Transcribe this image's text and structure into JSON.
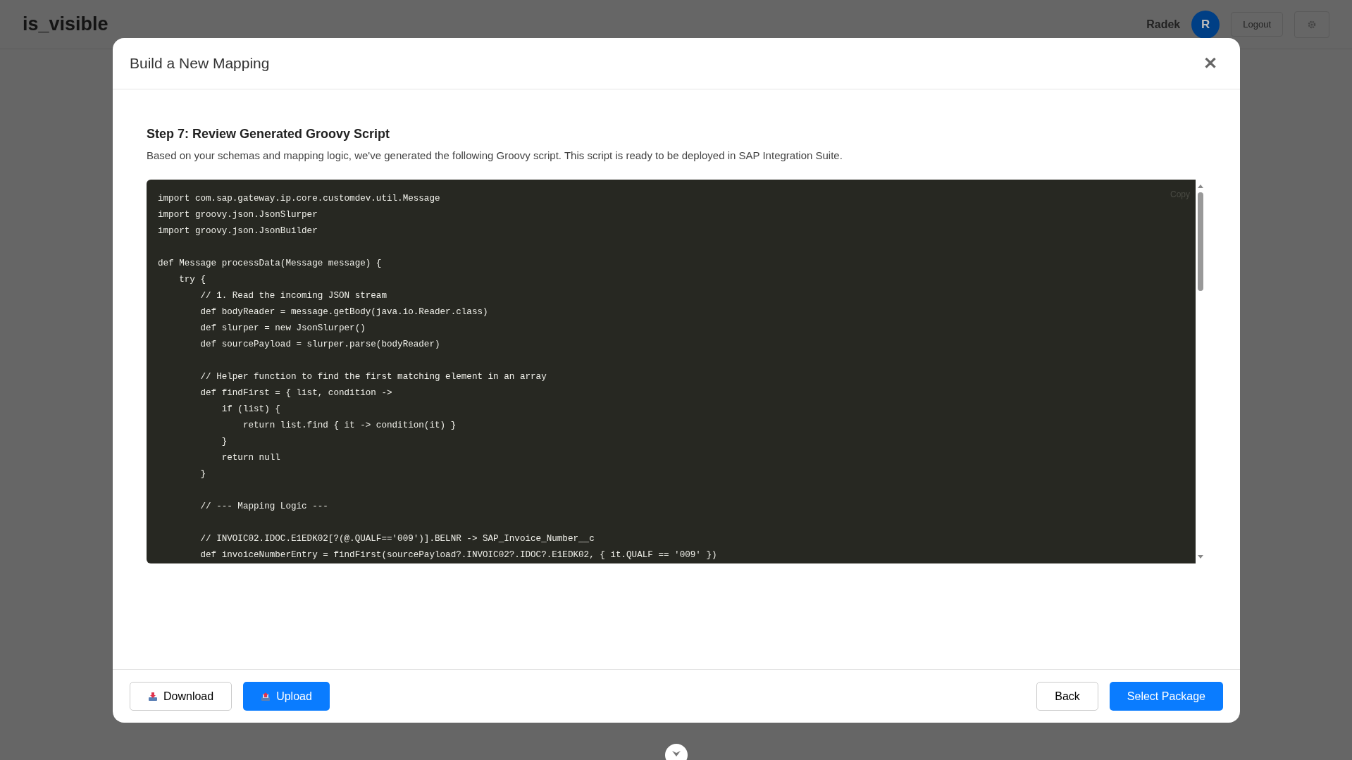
{
  "app_header": {
    "logo": "is_visible",
    "user_name": "Radek",
    "avatar_initial": "R",
    "logout": "Logout"
  },
  "dialog": {
    "title": "Build a New Mapping",
    "close": "✕",
    "step_title": "Step 7: Review Generated Groovy Script",
    "step_description": "Based on your schemas and mapping logic, we've generated the following Groovy script. This script is ready to be deployed in SAP Integration Suite.",
    "code": {
      "copy_label": "Copy",
      "text": "import com.sap.gateway.ip.core.customdev.util.Message\nimport groovy.json.JsonSlurper\nimport groovy.json.JsonBuilder\n\ndef Message processData(Message message) {\n    try {\n        // 1. Read the incoming JSON stream\n        def bodyReader = message.getBody(java.io.Reader.class)\n        def slurper = new JsonSlurper()\n        def sourcePayload = slurper.parse(bodyReader)\n\n        // Helper function to find the first matching element in an array\n        def findFirst = { list, condition ->\n            if (list) {\n                return list.find { it -> condition(it) }\n            }\n            return null\n        }\n\n        // --- Mapping Logic ---\n\n        // INVOIC02.IDOC.E1EDK02[?(@.QUALF=='009')].BELNR -> SAP_Invoice_Number__c\n        def invoiceNumberEntry = findFirst(sourcePayload?.INVOIC02?.IDOC?.E1EDK02, { it.QUALF == '009' })"
    },
    "footer_left": [
      {
        "label": "Download",
        "kind": "outline"
      },
      {
        "label": "Upload",
        "kind": "primary"
      }
    ],
    "footer_right": [
      {
        "label": "Back",
        "kind": "outline"
      },
      {
        "label": "Select Package",
        "kind": "primary"
      }
    ]
  }
}
